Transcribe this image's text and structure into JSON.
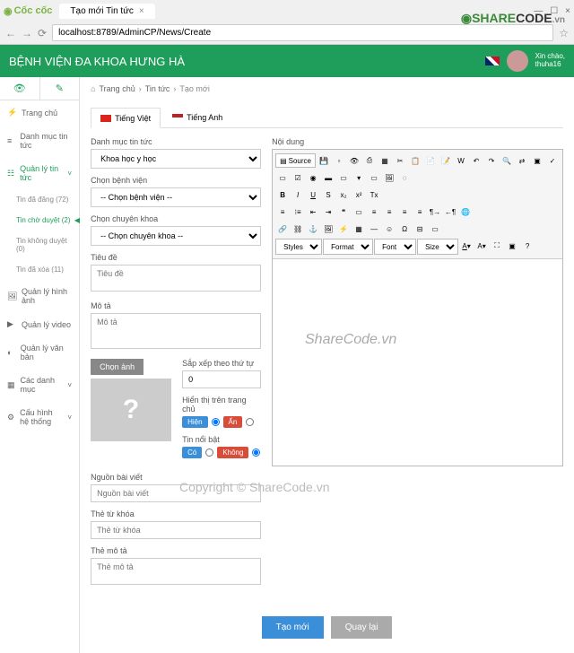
{
  "browser": {
    "logo": "Cốc cốc",
    "tab_title": "Tạo mới Tin tức",
    "url": "localhost:8789/AdminCP/News/Create"
  },
  "watermark": {
    "share": "SHARE",
    "code": "CODE",
    "vn": ".vn",
    "center": "ShareCode.vn",
    "copyright": "Copyright © ShareCode.vn"
  },
  "header": {
    "title": "BỆNH VIỆN ĐA KHOA HƯNG HÀ",
    "greeting": "Xin chào,",
    "username": "thuha16"
  },
  "sidebar": {
    "items": [
      {
        "icon": "⚡",
        "label": "Trang chủ"
      },
      {
        "icon": "≡",
        "label": "Danh mục tin tức"
      },
      {
        "icon": "☷",
        "label": "Quản lý tin tức",
        "expanded": true,
        "chev": "˅"
      },
      {
        "icon": "🖼",
        "label": "Quản lý hình ảnh"
      },
      {
        "icon": "▶",
        "label": "Quản lý video"
      },
      {
        "icon": "◐",
        "label": "Quản lý văn bản"
      },
      {
        "icon": "▦",
        "label": "Các danh mục",
        "chev": "˅"
      },
      {
        "icon": "⚙",
        "label": "Cấu hình hệ thống",
        "chev": "˅"
      }
    ],
    "submenu": [
      {
        "label": "Tin đã đăng (72)"
      },
      {
        "label": "Tin chờ duyệt (2)",
        "active": true
      },
      {
        "label": "Tin không duyệt (0)"
      },
      {
        "label": "Tin đã xóa (11)"
      }
    ]
  },
  "breadcrumb": {
    "home": "Trang chủ",
    "sep": "›",
    "lv1": "Tin tức",
    "lv2": "Tạo mới"
  },
  "tabs": {
    "vi": "Tiếng Việt",
    "en": "Tiếng Anh"
  },
  "form": {
    "category_label": "Danh mục tin tức",
    "category_value": "Khoa học y học",
    "hospital_label": "Chọn bệnh viện",
    "hospital_value": "-- Chọn bệnh viện --",
    "dept_label": "Chọn chuyên khoa",
    "dept_value": "-- Chọn chuyên khoa --",
    "title_label": "Tiêu đề",
    "title_ph": "Tiêu đề",
    "desc_label": "Mô tả",
    "desc_ph": "Mô tả",
    "choose_img": "Chọn ảnh",
    "sort_label": "Sắp xếp theo thứ tự",
    "sort_value": "0",
    "show_label": "Hiển thị trên trang chủ",
    "show_yes": "Hiện",
    "show_no": "Ẩn",
    "featured_label": "Tin nổi bật",
    "featured_yes": "Có",
    "featured_no": "Không",
    "source_label": "Nguồn bài viết",
    "source_ph": "Nguồn bài viết",
    "keyword_label": "Thẻ từ khóa",
    "keyword_ph": "Thẻ từ khóa",
    "metadesc_label": "Thẻ mô tả",
    "metadesc_ph": "Thẻ mô tả",
    "content_label": "Nội dung"
  },
  "editor": {
    "source": "Source",
    "styles": "Styles",
    "format": "Format",
    "font": "Font",
    "size": "Size"
  },
  "footer": {
    "create": "Tạo mới",
    "back": "Quay lại"
  }
}
